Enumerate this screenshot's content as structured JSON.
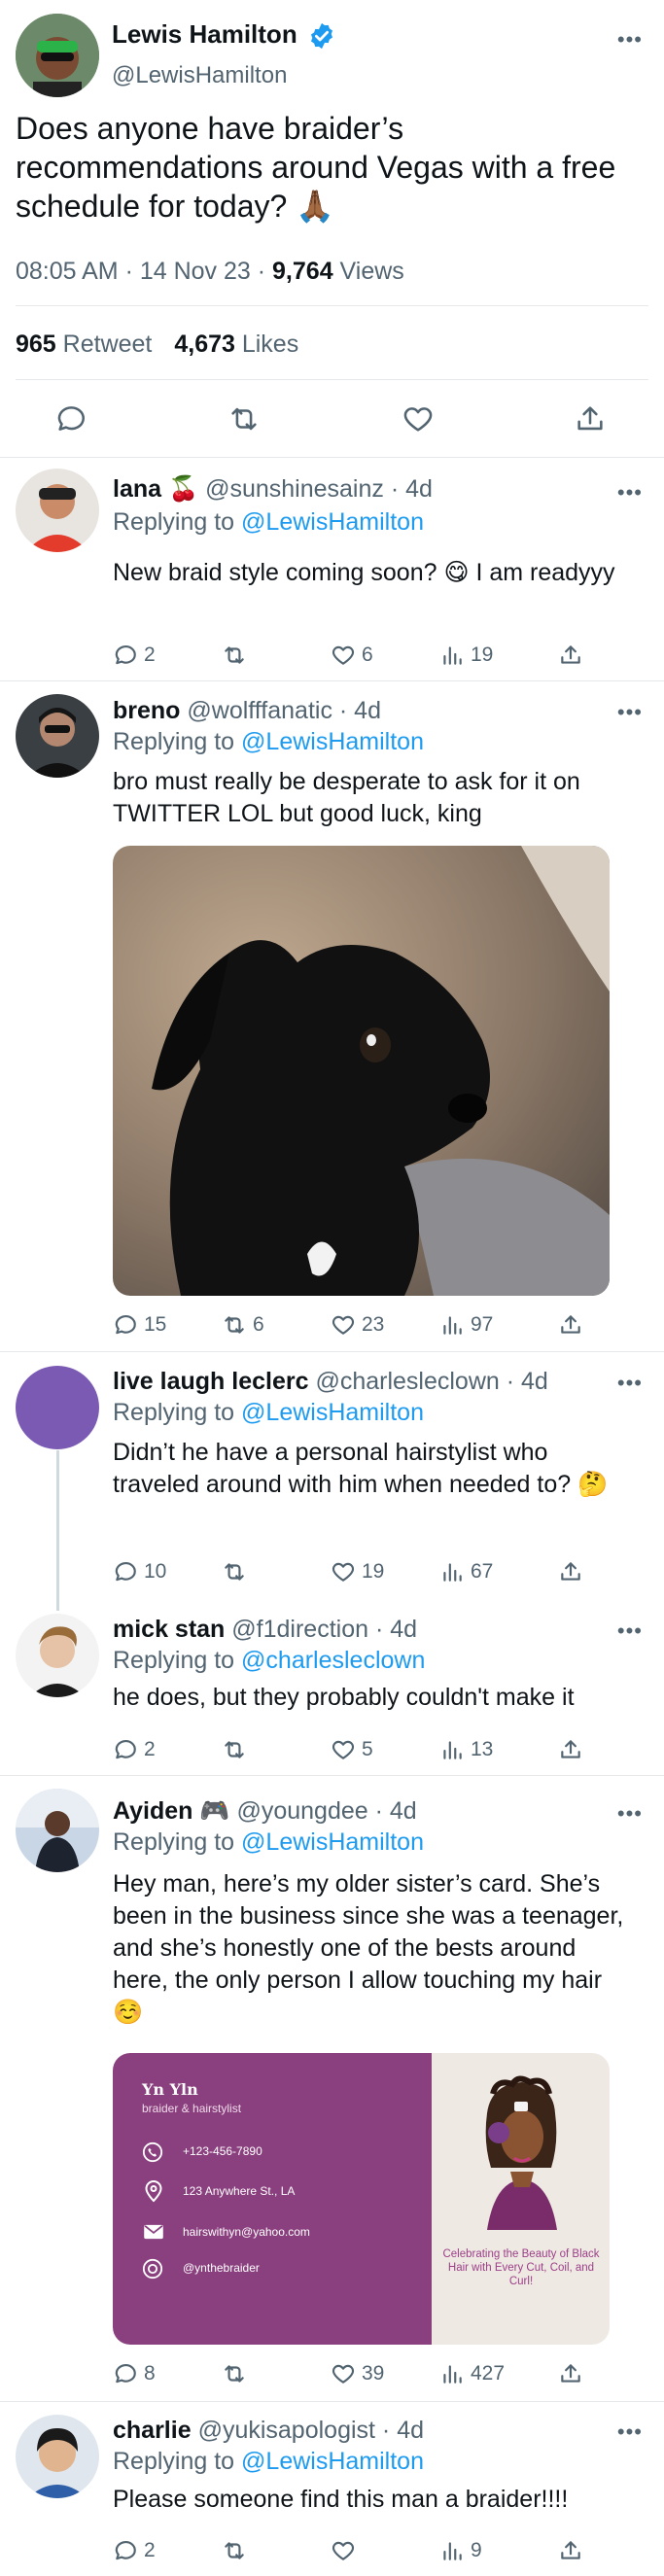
{
  "main_tweet": {
    "author_name": "Lewis Hamilton",
    "handle": "@LewisHamilton",
    "text": "Does anyone have braider’s recommendations around Vegas with a free schedule for today? 🙏🏾",
    "meta_time_date": "08:05 AM · 14 Nov 23 · ",
    "views_count": "9,764",
    "views_label": " Views",
    "retweets_count": "965",
    "retweets_label": " Retweet",
    "likes_count": "4,673",
    "likes_label": " Likes",
    "more_icon": "•••"
  },
  "replies": [
    {
      "name": "lana 🍒",
      "handle": "@sunshinesainz · 4d",
      "replying_label": "Replying to ",
      "replying_to": "@LewisHamilton",
      "text": "New braid style coming soon? 😋  I am readyyy",
      "replies": "2",
      "retweets": "",
      "likes": "6",
      "views": "19"
    },
    {
      "name": "breno",
      "handle": "@wolfffanatic · 4d",
      "replying_label": "Replying to ",
      "replying_to": "@LewisHamilton",
      "text": "bro must really be desperate to ask for it on TWITTER LOL but good luck, king",
      "replies": "15",
      "retweets": "6",
      "likes": "23",
      "views": "97"
    },
    {
      "name": "live laugh leclerc",
      "handle": "@charlesleclown · 4d",
      "replying_label": "Replying to ",
      "replying_to": "@LewisHamilton",
      "text": "Didn’t he have a personal hairstylist who traveled around with him when needed to? 🤔",
      "replies": "10",
      "retweets": "",
      "likes": "19",
      "views": "67"
    },
    {
      "name": "mick stan",
      "handle": "@f1direction · 4d",
      "replying_label": "Replying to ",
      "replying_to": "@charlesleclown",
      "text": "he does, but they probably couldn't make it",
      "replies": "2",
      "retweets": "",
      "likes": "5",
      "views": "13"
    },
    {
      "name": "Ayiden 🎮",
      "handle": "@youngdee · 4d",
      "replying_label": "Replying to ",
      "replying_to": "@LewisHamilton",
      "text": "Hey man, here’s my older sister’s card. She’s been in the business since she was a teenager, and she’s honestly one of the bests around here, the only person I allow touching my hair ☺️",
      "replies": "8",
      "retweets": "",
      "likes": "39",
      "views": "427"
    },
    {
      "name": "charlie",
      "handle": "@yukisapologist · 4d",
      "replying_label": "Replying to ",
      "replying_to": "@LewisHamilton",
      "text": "Please someone find this man a braider!!!!",
      "replies": "2",
      "retweets": "",
      "likes": "",
      "views": "9"
    }
  ],
  "business_card": {
    "name": "Yn Yln",
    "subtitle": "braider & hairstylist",
    "phone": "+123-456-7890",
    "address": "123 Anywhere St., LA",
    "email": "hairswithyn@yahoo.com",
    "instagram": "@ynthebraider",
    "tagline": "Celebrating the Beauty of Black Hair with Every Cut, Coil, and Curl!",
    "colors": {
      "card_bg": "#8a3f7e",
      "panel_bg": "#efe9e4",
      "tagline": "#9b3f87"
    }
  },
  "colors": {
    "accent": "#1d9bf0",
    "muted": "#536471",
    "thread_avatar": "#7b5ab3"
  }
}
